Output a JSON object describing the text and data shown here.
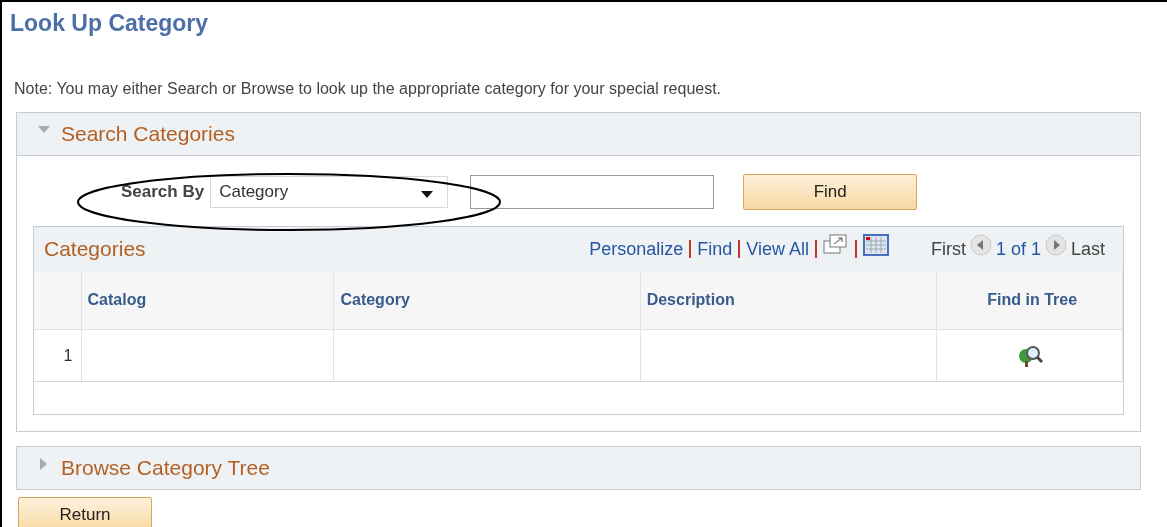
{
  "title": "Look Up Category",
  "note": "Note: You may either Search or Browse to look up the appropriate category for your special request.",
  "sections": [
    {
      "title": "Search Categories",
      "expanded": true
    },
    {
      "title": "Browse Category Tree",
      "expanded": false
    }
  ],
  "search": {
    "label": "Search By",
    "select_value": "Category",
    "button": "Find"
  },
  "grid": {
    "title": "Categories",
    "links": [
      "Personalize",
      "Find",
      "View All"
    ],
    "pager": {
      "first": "First",
      "range": "1 of 1",
      "last": "Last"
    },
    "columns": [
      "Catalog",
      "Category",
      "Description",
      "Find in Tree"
    ],
    "rows": [
      {
        "number": "1",
        "cells": [
          "",
          "",
          ""
        ]
      }
    ]
  },
  "return_button": "Return"
}
